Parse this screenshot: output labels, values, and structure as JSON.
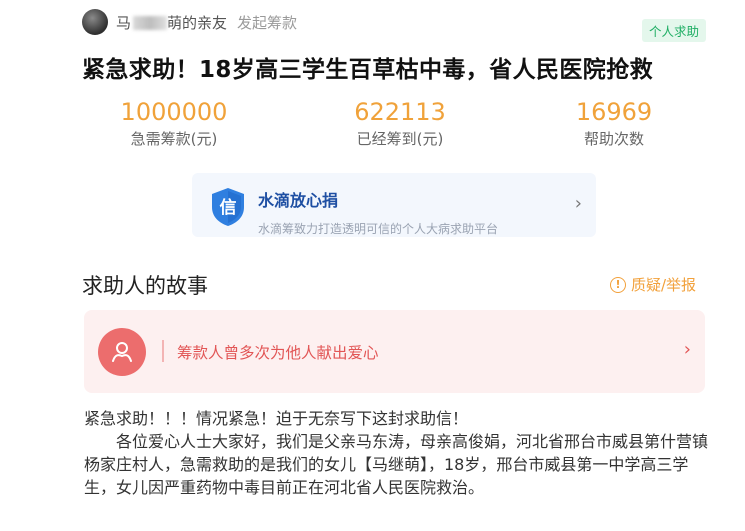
{
  "header": {
    "username_visible": "马",
    "username_suffix": "萌的亲友",
    "initiated_label": "发起筹款",
    "tag": "个人求助"
  },
  "title": "紧急求助！18岁高三学生百草枯中毒，省人民医院抢救",
  "stats": [
    {
      "value": "1000000",
      "label": "急需筹款(元)"
    },
    {
      "value": "622113",
      "label": "已经筹到(元)"
    },
    {
      "value": "16969",
      "label": "帮助次数"
    }
  ],
  "trust_card": {
    "icon_text": "信",
    "title": "水滴放心捐",
    "subtitle": "水滴筹致力打造透明可信的个人大病求助平台",
    "arrow_icon": "chevron-right-icon"
  },
  "section": {
    "title": "求助人的故事",
    "report_label": "质疑/举报"
  },
  "notice": {
    "text": "筹款人曾多次为他人献出爱心",
    "arrow_icon": "chevron-right-icon"
  },
  "story": {
    "line1": "紧急求助！！！情况紧急！迫于无奈写下这封求助信！",
    "paragraph": "各位爱心人士大家好，我们是父亲马东涛，母亲高俊娟，河北省邢台市威县第什营镇杨家庄村人，急需救助的是我们的女儿【马继萌】，18岁，邢台市威县第一中学高三学生，女儿因严重药物中毒目前正在河北省人民医院救治。"
  },
  "colors": {
    "accent_orange": "#f0a23a",
    "tag_green": "#1fae64",
    "brand_blue": "#1e4fa3",
    "notice_red": "#e25656"
  }
}
